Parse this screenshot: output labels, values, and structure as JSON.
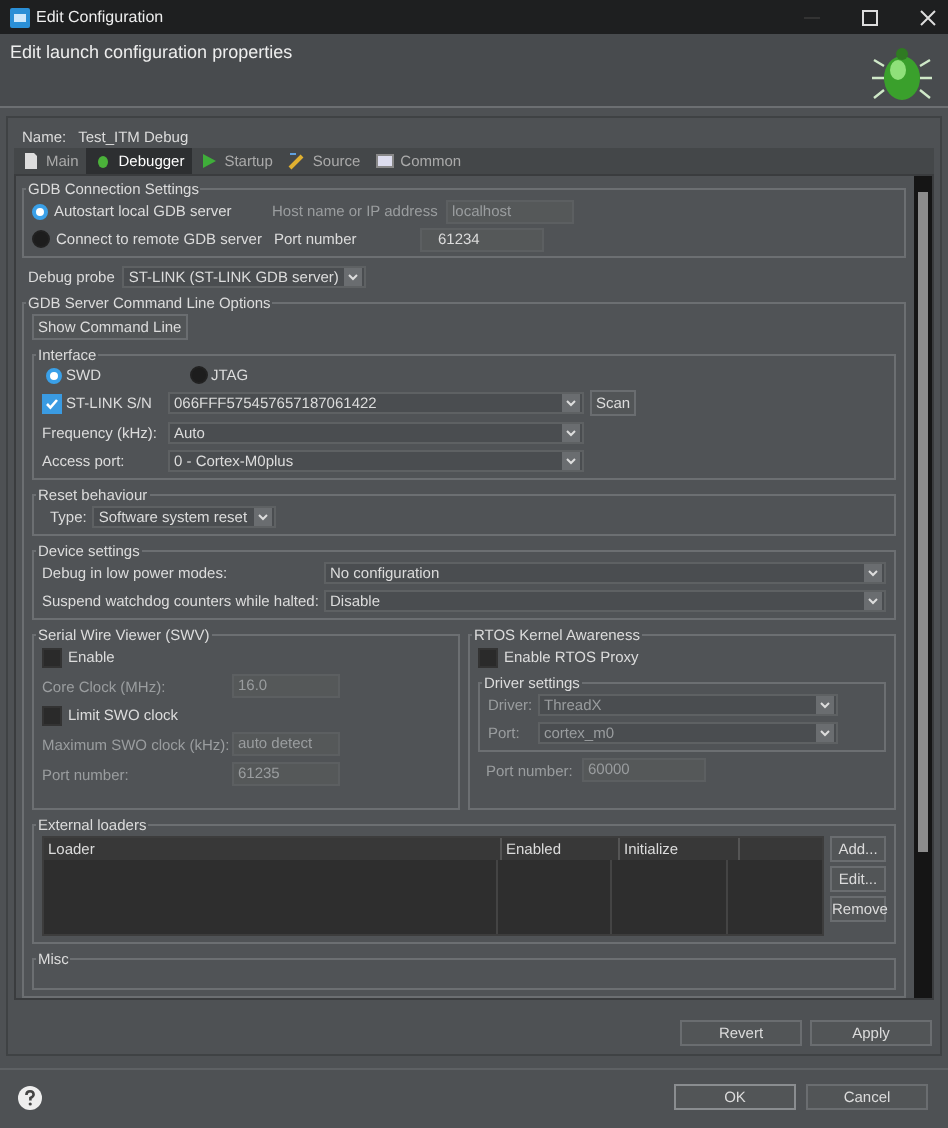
{
  "window": {
    "title": "Edit Configuration"
  },
  "header": {
    "title": "Edit launch configuration properties"
  },
  "name": {
    "label": "Name:",
    "value": "Test_ITM Debug"
  },
  "tabs": [
    {
      "label": "Main",
      "selected": false
    },
    {
      "label": "Debugger",
      "selected": true
    },
    {
      "label": "Startup",
      "selected": false
    },
    {
      "label": "Source",
      "selected": false
    },
    {
      "label": "Common",
      "selected": false
    }
  ],
  "gdb_connection": {
    "title": "GDB Connection Settings",
    "options": [
      {
        "label": "Autostart local GDB server",
        "selected": true
      },
      {
        "label": "Connect to remote GDB server",
        "selected": false
      }
    ],
    "host": {
      "label": "Host name or IP address",
      "value": "localhost",
      "disabled": true
    },
    "port": {
      "label": "Port number",
      "value": "61234",
      "disabled": false
    }
  },
  "debug_probe": {
    "label": "Debug probe",
    "value": "ST-LINK (ST-LINK GDB server)"
  },
  "server_options": {
    "title": "GDB Server Command Line Options",
    "show_command_line": "Show Command Line",
    "interface": {
      "title": "Interface",
      "modes": [
        {
          "label": "SWD",
          "selected": true
        },
        {
          "label": "JTAG",
          "selected": false
        }
      ],
      "serial": {
        "label": "ST-LINK S/N",
        "checked": true,
        "value": "066FFF575457657187061422",
        "scan": "Scan"
      },
      "fields": [
        {
          "label": "Frequency (kHz):",
          "value": "Auto"
        },
        {
          "label": "Access port:",
          "value": "0 - Cortex-M0plus"
        }
      ]
    },
    "reset": {
      "title": "Reset behaviour",
      "label": "Type:",
      "value": "Software system reset"
    },
    "device": {
      "title": "Device settings",
      "fields": [
        {
          "label": "Debug in low power modes:",
          "value": "No configuration"
        },
        {
          "label": "Suspend watchdog counters while halted:",
          "value": "Disable"
        }
      ]
    },
    "swv": {
      "title": "Serial Wire Viewer (SWV)",
      "items": [
        {
          "kind": "checkbox",
          "label": "Enable",
          "checked": false,
          "disabled": false
        },
        {
          "kind": "field",
          "label": "Core Clock (MHz):",
          "value": "16.0",
          "disabled": true
        },
        {
          "kind": "checkbox",
          "label": "Limit SWO clock",
          "checked": false,
          "disabled": false
        },
        {
          "kind": "field",
          "label": "Maximum SWO clock (kHz):",
          "value": "auto detect",
          "disabled": true
        },
        {
          "kind": "field",
          "label": "Port number:",
          "value": "61235",
          "disabled": true
        }
      ]
    },
    "rtos": {
      "title": "RTOS Kernel Awareness",
      "enable": {
        "label": "Enable RTOS Proxy",
        "checked": false
      },
      "driver": {
        "title": "Driver settings",
        "fields": [
          {
            "label": "Driver:",
            "value": "ThreadX",
            "disabled": true
          },
          {
            "label": "Port:",
            "value": "cortex_m0",
            "disabled": true
          }
        ]
      },
      "port": {
        "label": "Port number:",
        "value": "60000",
        "disabled": true
      }
    },
    "loaders": {
      "title": "External loaders",
      "columns": [
        "Loader",
        "Enabled",
        "Initialize"
      ],
      "buttons": [
        "Add...",
        "Edit...",
        "Remove"
      ]
    },
    "misc": {
      "title": "Misc"
    }
  },
  "buttons": [
    "Revert",
    "Apply"
  ],
  "dialog_buttons": [
    "OK",
    "Cancel"
  ]
}
